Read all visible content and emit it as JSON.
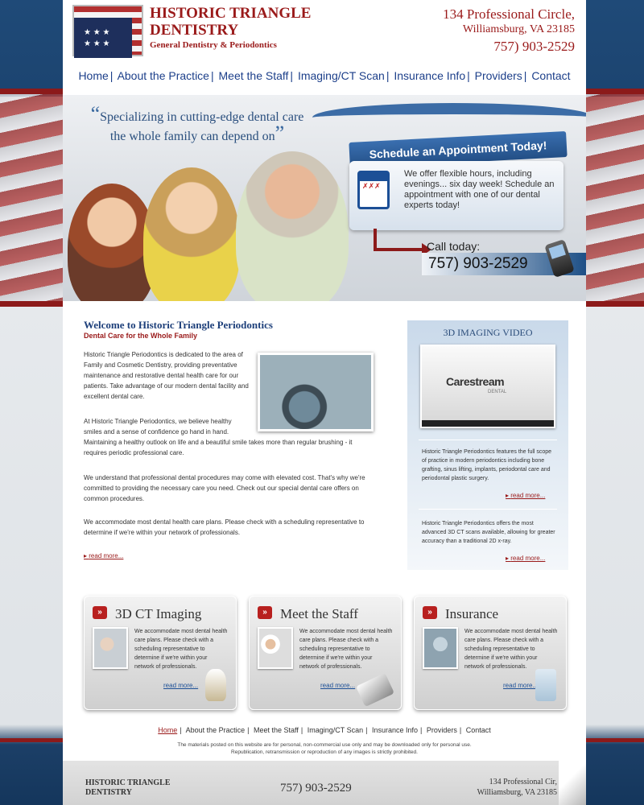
{
  "header": {
    "logo_title": "HISTORIC TRIANGLE DENTISTRY",
    "logo_sub": "General Dentistry & Periodontics",
    "address_line1": "134 Professional Circle,",
    "address_line2": "Williamsburg, VA 23185",
    "phone": "757) 903-2529"
  },
  "nav": [
    "Home",
    "About the Practice",
    "Meet the Staff",
    "Imaging/CT Scan",
    "Insurance Info",
    "Providers",
    "Contact"
  ],
  "hero": {
    "quote_line1": "Specializing in cutting-edge dental care",
    "quote_line2": "the whole family can depend on",
    "schedule_title": "Schedule an Appointment Today!",
    "schedule_text": "We offer flexible hours, including evenings... six day week! Schedule an appointment with one of our dental experts today!",
    "call_label": "Call today:",
    "call_number": "757) 903-2529"
  },
  "main": {
    "title": "Welcome to Historic Triangle Periodontics",
    "subtitle": "Dental Care for the Whole Family",
    "p1": "Historic Triangle Periodontics is dedicated to the area of Family and Cosmetic Dentistry, providing preventative maintenance and restorative dental health care for our patients. Take advantage of our modern dental facility and excellent dental care.",
    "p2a": "At Historic Triangle Periodontics, we believe healthy smiles and a sense of confidence go hand in hand.",
    "p2b": "Maintaining a healthy outlook on life and a beautiful smile takes more than regular brushing - it requires periodic professional care.",
    "p3": "We understand that professional dental procedures may come with elevated cost. That's why we're committed to providing the necessary care you need. Check out our special dental care offers on common procedures.",
    "p4": "We accommodate most dental health care plans. Please check with a scheduling representative to determine if we're within your network of professionals.",
    "read_more": "read more..."
  },
  "sidebar": {
    "title": "3D IMAGING VIDEO",
    "video_logo": "Carestream",
    "video_logo_sub": "DENTAL",
    "text1": "Historic Triangle Periodontics features the full scope of practice in modern periodontics including bone grafting, sinus lifting, implants, periodontal care and periodontal plastic surgery.",
    "text2": "Historic Triangle Periodontics offers the most advanced 3D CT scans available, allowing for greater accuracy than a traditional 2D x-ray.",
    "read_more": "read more..."
  },
  "features": [
    {
      "title": "3D CT Imaging",
      "text": "We accommodate most dental health care plans. Please check with a scheduling representative to determine if we're within your network of professionals.",
      "more": "read more..."
    },
    {
      "title": "Meet the Staff",
      "text": "We accommodate most dental health care plans. Please check with a scheduling representative to determine if we're within your network of professionals.",
      "more": "read more..."
    },
    {
      "title": "Insurance",
      "text": "We accommodate most dental health care plans. Please check with a scheduling representative to determine if we're within your network of professionals.",
      "more": "read more..."
    }
  ],
  "footer": {
    "nav": [
      "Home",
      "About the Practice",
      "Meet the Staff",
      "Imaging/CT Scan",
      "Insurance Info",
      "Providers",
      "Contact"
    ],
    "note1": "The materials posted on this website are for personal, non-commercial use only and may be downloaded only for personal use.",
    "note2": "Republication, retransmission or reproduction of any images is strictly prohibited.",
    "logo": "HISTORIC TRIANGLE DENTISTRY",
    "phone": "757) 903-2529",
    "address_line1": "134 Professional Cir,",
    "address_line2": "Williamsburg, VA 23185"
  },
  "colors": {
    "brand_red": "#9a1a1a",
    "nav_blue": "#1c3f8a",
    "title_blue": "#1d3f7a"
  }
}
